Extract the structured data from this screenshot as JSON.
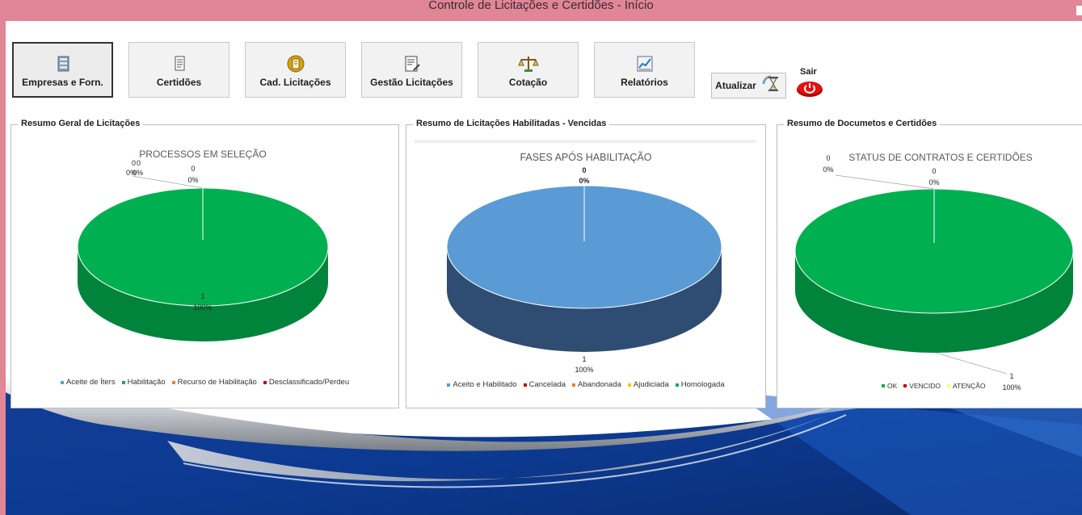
{
  "window": {
    "title": "Controle de Licitações e Certidões - Início"
  },
  "toolbar": {
    "buttons": [
      {
        "label": "Empresas e Forn.",
        "icon": "database-icon"
      },
      {
        "label": "Certidões",
        "icon": "document-icon"
      },
      {
        "label": "Cad. Licitações",
        "icon": "notebook-icon"
      },
      {
        "label": "Gestão Licitações",
        "icon": "list-edit-icon"
      },
      {
        "label": "Cotação",
        "icon": "scales-icon"
      },
      {
        "label": "Relatórios",
        "icon": "report-chart-icon"
      }
    ],
    "refresh_label": "Atualizar",
    "exit_label": "Sair"
  },
  "colors": {
    "accent": "#e08697",
    "green": "#00b050",
    "blue": "#5b9bd5",
    "red": "#c00000",
    "orange": "#ed7d31",
    "yellow": "#ffc000"
  },
  "panels": [
    {
      "title": "Resumo Geral de Licitações"
    },
    {
      "title": "Resumo de Licitações Habilitadas - Vencidas"
    },
    {
      "title": "Resumo de Documetos e Certidões"
    }
  ],
  "chart_data": [
    {
      "type": "pie",
      "title": "PROCESSOS EM SELEÇÃO",
      "categories": [
        "Aceite de Íters",
        "Habilitação",
        "Recurso de Habilitação",
        "Desclassificado/Perdeu"
      ],
      "values": [
        0,
        1,
        0,
        0
      ],
      "labels": [
        {
          "value": "0",
          "pct": "0%"
        },
        {
          "value": "1",
          "pct": "100%"
        },
        {
          "value": "0",
          "pct": "0%"
        },
        {
          "value": "0",
          "pct": "0%"
        }
      ],
      "colors": [
        "#5b9bd5",
        "#00b050",
        "#ed7d31",
        "#c00000"
      ],
      "legend": "bottom"
    },
    {
      "type": "pie",
      "title": "FASES APÓS HABILITAÇÃO",
      "categories": [
        "Aceito e Habilitado",
        "Cancelada",
        "Abandonada",
        "Ajudiciada",
        "Homologada"
      ],
      "values": [
        1,
        0,
        0,
        0,
        0
      ],
      "labels": [
        {
          "value": "1",
          "pct": "100%"
        },
        {
          "value": "0",
          "pct": "0%"
        },
        {
          "value": "0",
          "pct": "0%"
        },
        {
          "value": "0",
          "pct": "0%"
        },
        {
          "value": "0",
          "pct": "0%"
        }
      ],
      "colors": [
        "#5b9bd5",
        "#c00000",
        "#ed7d31",
        "#ffc000",
        "#00b050"
      ],
      "legend": "bottom"
    },
    {
      "type": "pie",
      "title": "STATUS DE CONTRATOS E CERTIDÕES",
      "categories": [
        "OK",
        "VENCIDO",
        "ATENÇÃO"
      ],
      "values": [
        1,
        0,
        0
      ],
      "labels": [
        {
          "value": "1",
          "pct": "100%"
        },
        {
          "value": "0",
          "pct": "0%"
        },
        {
          "value": "0",
          "pct": "0%"
        }
      ],
      "colors": [
        "#00b050",
        "#c00000",
        "#ffff66"
      ],
      "legend": "bottom"
    }
  ]
}
